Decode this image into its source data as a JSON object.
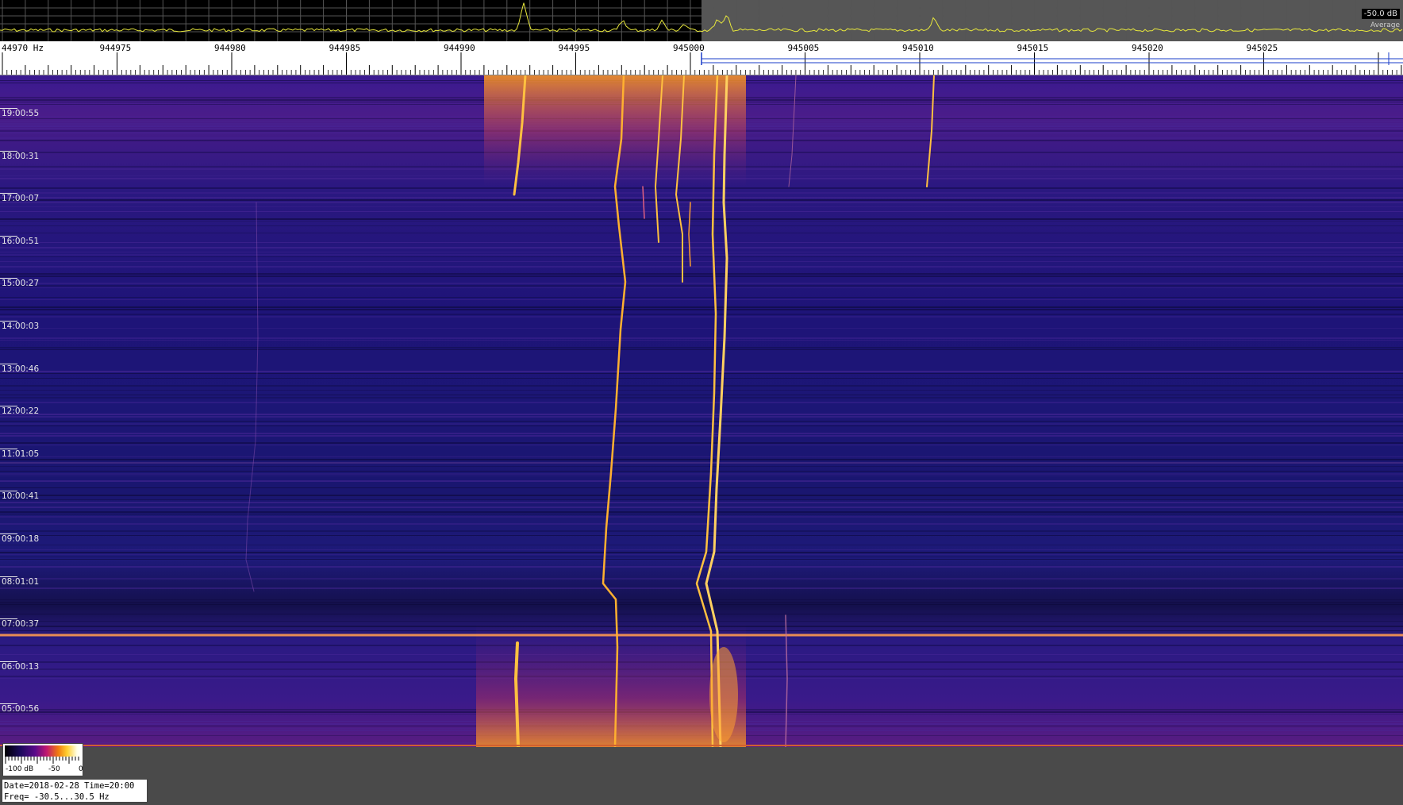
{
  "spectrum": {
    "db_readout": "-50.0 dB",
    "avg_label": "Average",
    "trace_color": "#e8e83c"
  },
  "ruler": {
    "labels": [
      "44970 Hz",
      "944975",
      "944980",
      "944985",
      "944990",
      "944995",
      "945000",
      "945005",
      "945010",
      "945015",
      "945020",
      "945025"
    ],
    "marker_color": "#1a3cc8"
  },
  "waterfall": {
    "time_labels": [
      "19:00:55",
      "18:00:31",
      "17:00:07",
      "16:00:51",
      "15:00:27",
      "14:00:03",
      "13:00:46",
      "12:00:22",
      "11:01:05",
      "10:00:41",
      "09:00:18",
      "08:01:01",
      "07:00:37",
      "06:00:13",
      "05:00:56"
    ],
    "colors": {
      "low": "#1c1470",
      "mid": "#2a1a8c",
      "hot": "#ffb020",
      "peak": "#ffe070"
    }
  },
  "colorbar": {
    "min_label": "-100 dB",
    "mid_label": "-50",
    "max_label": "0"
  },
  "info": {
    "date_time": "Date=2018-02-28 Time=20:00",
    "freq": "Freq= -30.5...30.5 Hz"
  }
}
